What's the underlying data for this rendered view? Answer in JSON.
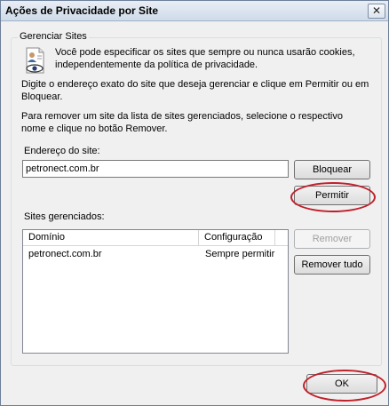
{
  "window": {
    "title": "Ações de Privacidade por Site",
    "close_glyph": "✕"
  },
  "group": {
    "label": "Gerenciar Sites"
  },
  "info": {
    "text": "Você pode especificar os sites que sempre ou nunca usarão cookies, independentemente da política de privacidade.",
    "icon": "privacy-document-icon"
  },
  "instructions": {
    "manage": "Digite o endereço exato do site que deseja gerenciar e clique em Permitir ou em Bloquear.",
    "remove": "Para remover um site da lista de sites gerenciados, selecione o respectivo nome e clique no botão Remover."
  },
  "address": {
    "label": "Endereço do site:",
    "value": "petronect.com.br"
  },
  "buttons": {
    "block": "Bloquear",
    "allow": "Permitir",
    "remove": "Remover",
    "remove_all": "Remover tudo",
    "ok": "OK"
  },
  "managed": {
    "label": "Sites gerenciados:",
    "columns": [
      "Domínio",
      "Configuração"
    ],
    "rows": [
      {
        "domain": "petronect.com.br",
        "setting": "Sempre permitir"
      }
    ]
  },
  "colors": {
    "highlight_ellipse": "#c0202a"
  }
}
